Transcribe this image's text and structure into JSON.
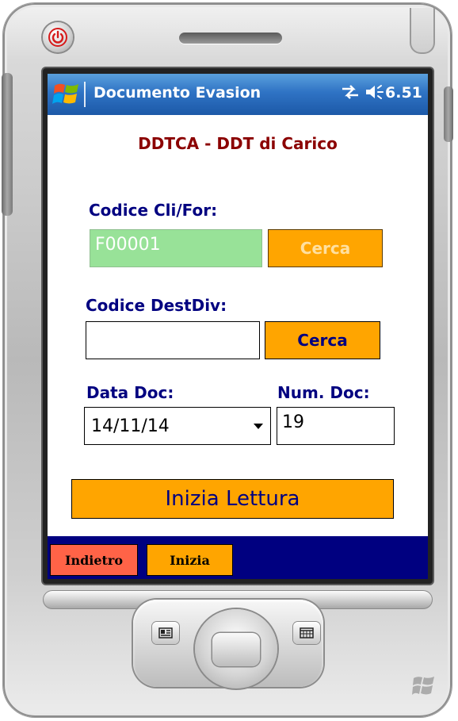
{
  "window": {
    "title": "Documento Evasion",
    "clock": "6.51"
  },
  "form": {
    "title": "DDTCA - DDT di Carico",
    "codice_cli_for": {
      "label": "Codice Cli/For:",
      "value": "F00001",
      "search_label": "Cerca"
    },
    "codice_destdiv": {
      "label": "Codice DestDiv:",
      "value": "",
      "search_label": "Cerca"
    },
    "data_doc": {
      "label": "Data Doc:",
      "value": "14/11/14"
    },
    "num_doc": {
      "label": "Num. Doc:",
      "value": "19"
    },
    "start_button_label": "Inizia Lettura"
  },
  "softkeys": {
    "left": "Indietro",
    "right": "Inizia"
  },
  "colors": {
    "title_bar": "#2f73c4",
    "form_title": "#8b0000",
    "labels": "#000080",
    "button_orange": "#ffa500",
    "disabled_field": "#98e298",
    "bottom_bar": "#000080",
    "indietro_key": "#ff6347"
  },
  "icons": {
    "power": "power-icon",
    "start": "windows-logo-icon",
    "connectivity": "connectivity-icon",
    "volume": "volume-icon",
    "dropdown": "chevron-down-icon",
    "contacts": "contacts-icon",
    "calendar": "calendar-icon"
  }
}
